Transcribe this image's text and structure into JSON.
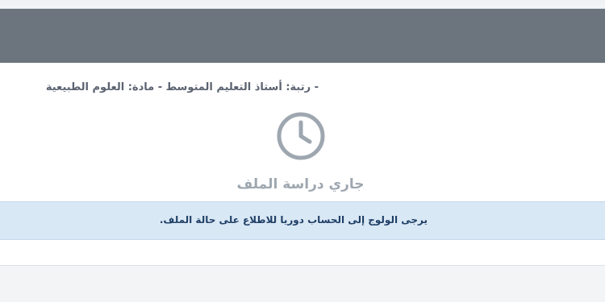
{
  "card": {
    "header_color": "#6c757d",
    "subtitle": "- رتبة: أستاذ التعليم المتوسط - مادة: العلوم الطبيعية"
  },
  "status": {
    "icon": "clock-icon",
    "icon_color": "#9ea7b0",
    "title": "جاري دراسة الملف"
  },
  "alert": {
    "color": "#d9e8f5",
    "message": "يرجى الولوج إلى الحساب دوريا للاطلاع على حالة الملف."
  }
}
